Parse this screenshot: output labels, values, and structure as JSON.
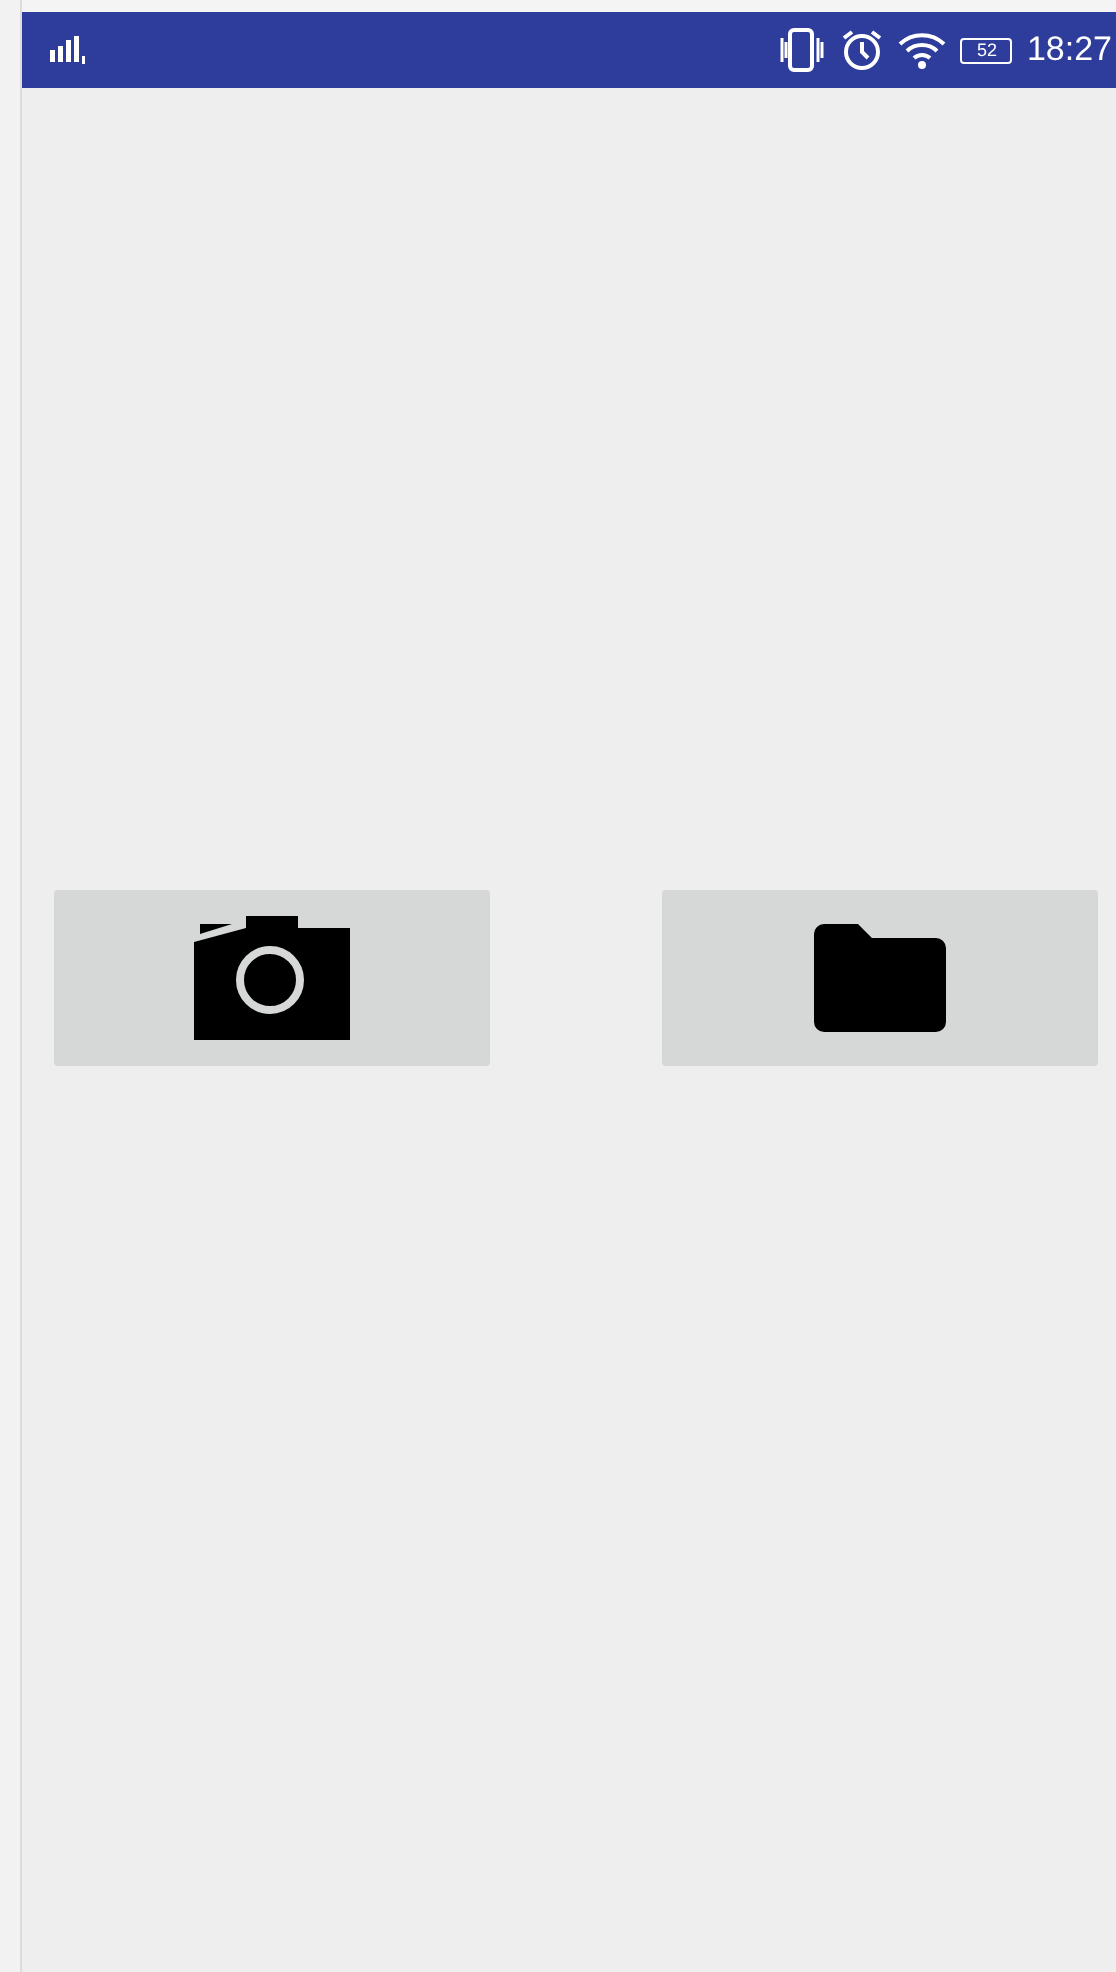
{
  "status_bar": {
    "battery": "52",
    "time": "18:27"
  },
  "buttons": [
    {
      "kind": "camera"
    },
    {
      "kind": "folder"
    }
  ]
}
